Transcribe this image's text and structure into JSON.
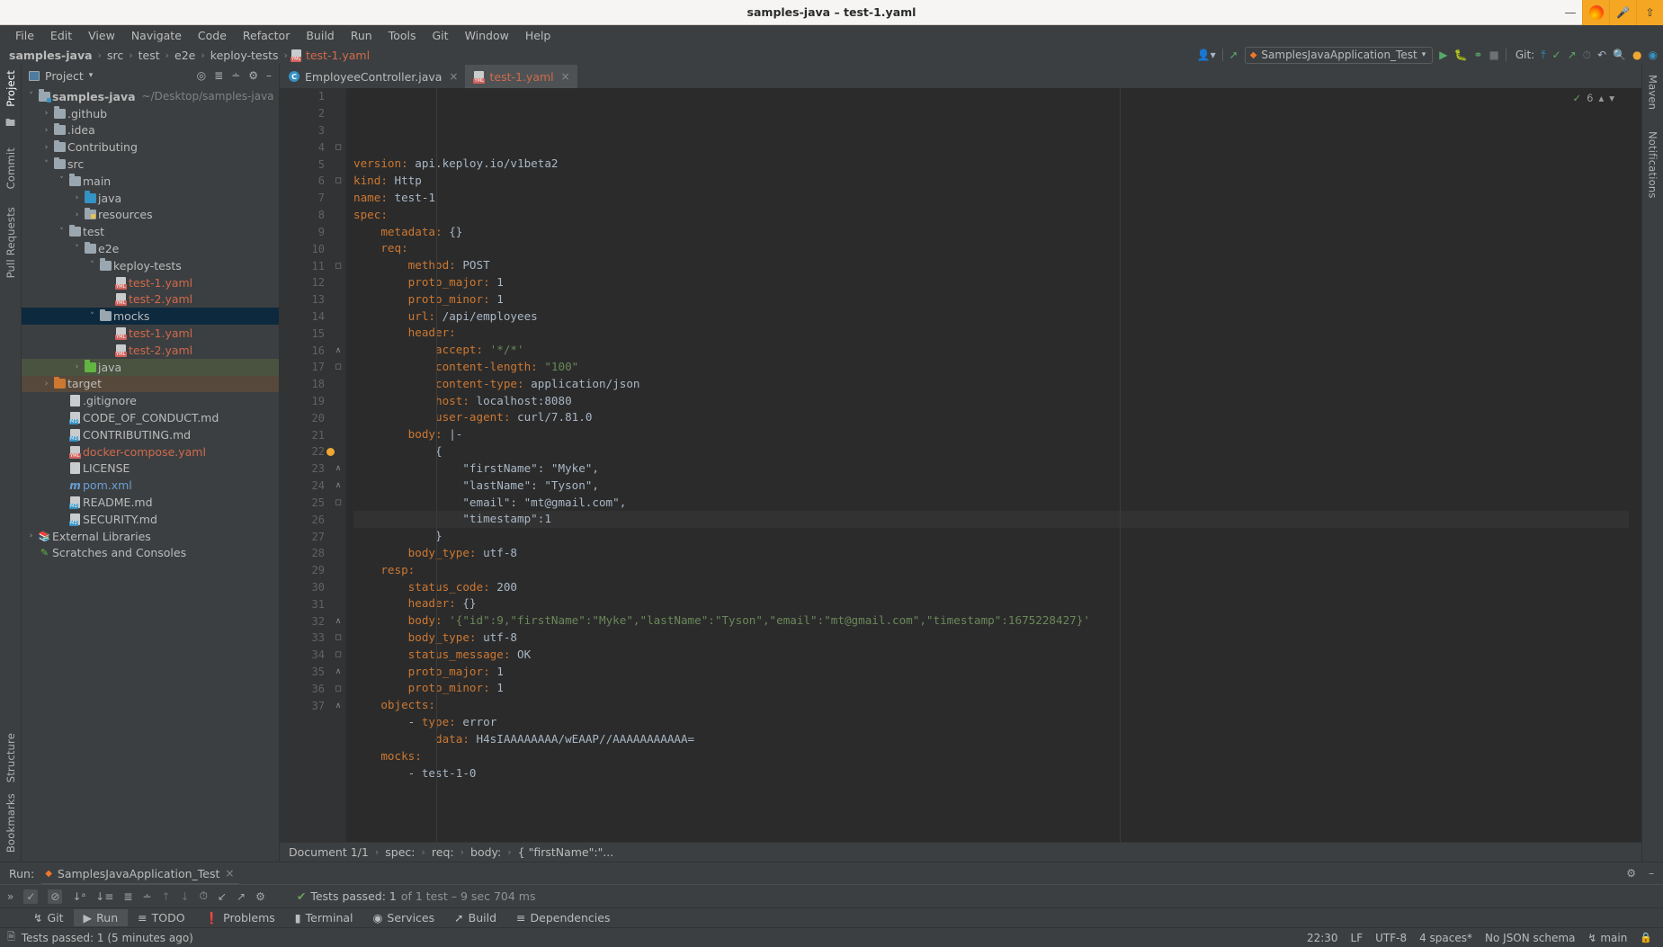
{
  "window": {
    "title": "samples-java – test-1.yaml",
    "minimize": "—",
    "tray": {
      "firefox": "firefox-icon",
      "mic": "microphone-icon",
      "upload": "upload-icon"
    }
  },
  "menubar": [
    "File",
    "Edit",
    "View",
    "Navigate",
    "Code",
    "Refactor",
    "Build",
    "Run",
    "Tools",
    "Git",
    "Window",
    "Help"
  ],
  "navbar": {
    "crumbs": [
      "samples-java",
      "src",
      "test",
      "e2e",
      "keploy-tests"
    ],
    "file": "test-1.yaml",
    "separator": "›"
  },
  "toolbar": {
    "profile_icon": "user-profile-icon",
    "updates_icon": "chevron-up-icon",
    "run_config": "SamplesJavaApplication_Test",
    "run": "run-icon",
    "debug": "debug-icon",
    "coverage": "run-with-coverage-icon",
    "stop": "stop-icon",
    "git_label": "Git:",
    "git_update": "update-project-icon",
    "git_commit": "commit-icon",
    "git_push": "push-icon",
    "git_history": "history-icon",
    "git_rollback": "rollback-icon",
    "search": "search-icon",
    "plugin_update": "plugin-update-icon",
    "ai_assistant": "ai-assistant-icon"
  },
  "left_rail": [
    "Project",
    "Commit",
    "Pull Requests",
    "Bookmarks",
    "Structure"
  ],
  "right_rail": [
    "Maven",
    "Notifications"
  ],
  "project_panel": {
    "title": "Project",
    "dropdown": "▾",
    "icons": [
      "locate-icon",
      "expand-all-icon",
      "collapse-all-icon",
      "settings-icon",
      "hide-icon"
    ],
    "tree": [
      {
        "label": "samples-java",
        "sub": "~/Desktop/samples-java",
        "depth": 0,
        "arrow": "down",
        "icon": "module",
        "bold": true
      },
      {
        "label": ".github",
        "depth": 1,
        "arrow": "right",
        "icon": "folder"
      },
      {
        "label": ".idea",
        "depth": 1,
        "arrow": "right",
        "icon": "folder"
      },
      {
        "label": "Contributing",
        "depth": 1,
        "arrow": "right",
        "icon": "folder"
      },
      {
        "label": "src",
        "depth": 1,
        "arrow": "down",
        "icon": "folder"
      },
      {
        "label": "main",
        "depth": 2,
        "arrow": "down",
        "icon": "folder"
      },
      {
        "label": "java",
        "depth": 3,
        "arrow": "right",
        "icon": "folder-blue"
      },
      {
        "label": "resources",
        "depth": 3,
        "arrow": "right",
        "icon": "folder-res"
      },
      {
        "label": "test",
        "depth": 2,
        "arrow": "down",
        "icon": "folder"
      },
      {
        "label": "e2e",
        "depth": 3,
        "arrow": "down",
        "icon": "folder"
      },
      {
        "label": "keploy-tests",
        "depth": 4,
        "arrow": "down",
        "icon": "folder"
      },
      {
        "label": "test-1.yaml",
        "depth": 5,
        "arrow": "none",
        "icon": "yaml"
      },
      {
        "label": "test-2.yaml",
        "depth": 5,
        "arrow": "none",
        "icon": "yaml"
      },
      {
        "label": "mocks",
        "depth": 4,
        "arrow": "down",
        "icon": "folder",
        "state": "selected"
      },
      {
        "label": "test-1.yaml",
        "depth": 5,
        "arrow": "none",
        "icon": "yaml"
      },
      {
        "label": "test-2.yaml",
        "depth": 5,
        "arrow": "none",
        "icon": "yaml"
      },
      {
        "label": "java",
        "depth": 3,
        "arrow": "right",
        "icon": "folder-green",
        "state": "test-source"
      },
      {
        "label": "target",
        "depth": 1,
        "arrow": "right",
        "icon": "folder-orange",
        "state": "excluded"
      },
      {
        "label": ".gitignore",
        "depth": 2,
        "arrow": "none",
        "icon": "gitignore"
      },
      {
        "label": "CODE_OF_CONDUCT.md",
        "depth": 2,
        "arrow": "none",
        "icon": "md"
      },
      {
        "label": "CONTRIBUTING.md",
        "depth": 2,
        "arrow": "none",
        "icon": "md"
      },
      {
        "label": "docker-compose.yaml",
        "depth": 2,
        "arrow": "none",
        "icon": "yaml"
      },
      {
        "label": "LICENSE",
        "depth": 2,
        "arrow": "none",
        "icon": "file"
      },
      {
        "label": "pom.xml",
        "depth": 2,
        "arrow": "none",
        "icon": "maven"
      },
      {
        "label": "README.md",
        "depth": 2,
        "arrow": "none",
        "icon": "md"
      },
      {
        "label": "SECURITY.md",
        "depth": 2,
        "arrow": "none",
        "icon": "md"
      },
      {
        "label": "External Libraries",
        "depth": 0,
        "arrow": "right",
        "icon": "library"
      },
      {
        "label": "Scratches and Consoles",
        "depth": 0,
        "arrow": "none",
        "icon": "scratch"
      }
    ]
  },
  "editor": {
    "tabs": [
      {
        "label": "EmployeeController.java",
        "icon": "java-class-icon",
        "active": false,
        "close": "×"
      },
      {
        "label": "test-1.yaml",
        "icon": "yaml-file-icon",
        "active": true,
        "close": "×"
      }
    ],
    "inspection_count": "6",
    "inspection_icon": "inspection-warning-icon",
    "lines": [
      {
        "n": 1,
        "fold": "",
        "text": "version: api.keploy.io/v1beta2",
        "key": "version",
        "indent": 0
      },
      {
        "n": 2,
        "fold": "",
        "text": "kind: Http",
        "key": "kind",
        "indent": 0
      },
      {
        "n": 3,
        "fold": "",
        "text": "name: test-1",
        "key": "name",
        "indent": 0
      },
      {
        "n": 4,
        "fold": "open",
        "text": "spec:",
        "key": "spec",
        "indent": 0
      },
      {
        "n": 5,
        "fold": "",
        "text": "metadata: {}",
        "key": "metadata",
        "indent": 1
      },
      {
        "n": 6,
        "fold": "open",
        "text": "req:",
        "key": "req",
        "indent": 1
      },
      {
        "n": 7,
        "fold": "",
        "text": "method: POST",
        "key": "method",
        "indent": 2
      },
      {
        "n": 8,
        "fold": "",
        "text": "proto_major: 1",
        "key": "proto_major",
        "indent": 2
      },
      {
        "n": 9,
        "fold": "",
        "text": "proto_minor: 1",
        "key": "proto_minor",
        "indent": 2
      },
      {
        "n": 10,
        "fold": "",
        "text": "url: /api/employees",
        "key": "url",
        "indent": 2
      },
      {
        "n": 11,
        "fold": "open",
        "text": "header:",
        "key": "header",
        "indent": 2
      },
      {
        "n": 12,
        "fold": "",
        "text": "accept: '*/*'",
        "key": "accept",
        "indent": 3
      },
      {
        "n": 13,
        "fold": "",
        "text": "content-length: \"100\"",
        "key": "content-length",
        "indent": 3
      },
      {
        "n": 14,
        "fold": "",
        "text": "content-type: application/json",
        "key": "content-type",
        "indent": 3
      },
      {
        "n": 15,
        "fold": "",
        "text": "host: localhost:8080",
        "key": "host",
        "indent": 3
      },
      {
        "n": 16,
        "fold": "close",
        "text": "user-agent: curl/7.81.0",
        "key": "user-agent",
        "indent": 3
      },
      {
        "n": 17,
        "fold": "open",
        "text": "body: |-",
        "key": "body",
        "indent": 2
      },
      {
        "n": 18,
        "fold": "",
        "text": "{",
        "indent": 3
      },
      {
        "n": 19,
        "fold": "",
        "text": "\"firstName\": \"Myke\",",
        "indent": 4
      },
      {
        "n": 20,
        "fold": "",
        "text": "\"lastName\": \"Tyson\",",
        "indent": 4
      },
      {
        "n": 21,
        "fold": "",
        "text": "\"email\": \"mt@gmail.com\",",
        "indent": 4
      },
      {
        "n": 22,
        "fold": "",
        "text": "\"timestamp\":1",
        "indent": 4,
        "gutter_icon": "intention-bulb-icon",
        "highlight": true
      },
      {
        "n": 23,
        "fold": "close",
        "text": "}",
        "indent": 3
      },
      {
        "n": 24,
        "fold": "close",
        "text": "body_type: utf-8",
        "key": "body_type",
        "indent": 2
      },
      {
        "n": 25,
        "fold": "open",
        "text": "resp:",
        "key": "resp",
        "indent": 1
      },
      {
        "n": 26,
        "fold": "",
        "text": "status_code: 200",
        "key": "status_code",
        "indent": 2
      },
      {
        "n": 27,
        "fold": "",
        "text": "header: {}",
        "key": "header",
        "indent": 2
      },
      {
        "n": 28,
        "fold": "",
        "text": "body: '{\"id\":9,\"firstName\":\"Myke\",\"lastName\":\"Tyson\",\"email\":\"mt@gmail.com\",\"timestamp\":1675228427}'",
        "key": "body",
        "indent": 2,
        "string_value": true
      },
      {
        "n": 29,
        "fold": "",
        "text": "body_type: utf-8",
        "key": "body_type",
        "indent": 2
      },
      {
        "n": 30,
        "fold": "",
        "text": "status_message: OK",
        "key": "status_message",
        "indent": 2
      },
      {
        "n": 31,
        "fold": "",
        "text": "proto_major: 1",
        "key": "proto_major",
        "indent": 2
      },
      {
        "n": 32,
        "fold": "close",
        "text": "proto_minor: 1",
        "key": "proto_minor",
        "indent": 2
      },
      {
        "n": 33,
        "fold": "open",
        "text": "objects:",
        "key": "objects",
        "indent": 1
      },
      {
        "n": 34,
        "fold": "open",
        "text": "- type: error",
        "key": "type",
        "indent": 2,
        "dash": true
      },
      {
        "n": 35,
        "fold": "close",
        "text": "data: H4sIAAAAAAAA/wEAAP//AAAAAAAAAAA=",
        "key": "data",
        "indent": 3
      },
      {
        "n": 36,
        "fold": "open",
        "text": "mocks:",
        "key": "mocks",
        "indent": 1
      },
      {
        "n": 37,
        "fold": "close",
        "text": "- test-1-0",
        "indent": 2,
        "dash": true
      }
    ],
    "crumbs": [
      "Document 1/1",
      "spec:",
      "req:",
      "body:",
      "{  \"firstName\":\"..."
    ],
    "crumb_sep": "›"
  },
  "run_window": {
    "label": "Run:",
    "tab": "SamplesJavaApplication_Test",
    "tab_icon": "run-config-icon",
    "close": "×",
    "settings_icon": "gear-icon",
    "hide_icon": "minimize-icon",
    "toolbar_icons": [
      "expand-more-icon",
      "show-passed-icon",
      "hide-ignored-icon",
      "sort-alpha-icon",
      "sort-duration-icon",
      "expand-all-icon",
      "collapse-all-icon",
      "prev-test-icon",
      "next-test-icon",
      "history-icon",
      "import-results-icon",
      "export-results-icon",
      "test-settings-icon"
    ],
    "status_check": "✔",
    "status_main": "Tests passed: 1",
    "status_detail": "of 1 test – 9 sec 704 ms"
  },
  "bottom_bar": [
    {
      "label": "Git",
      "icon": "git-branch-icon",
      "active": false
    },
    {
      "label": "Run",
      "icon": "run-icon",
      "active": true
    },
    {
      "label": "TODO",
      "icon": "todo-icon",
      "active": false
    },
    {
      "label": "Problems",
      "icon": "problems-icon",
      "active": false
    },
    {
      "label": "Terminal",
      "icon": "terminal-icon",
      "active": false
    },
    {
      "label": "Services",
      "icon": "services-icon",
      "active": false
    },
    {
      "label": "Build",
      "icon": "build-hammer-icon",
      "active": false
    },
    {
      "label": "Dependencies",
      "icon": "dependencies-icon",
      "active": false
    }
  ],
  "status_bar": {
    "message_icon": "event-log-icon",
    "message": "Tests passed: 1 (5 minutes ago)",
    "time": "22:30",
    "line_separator": "LF",
    "encoding": "UTF-8",
    "indent": "4 spaces*",
    "schema": "No JSON schema",
    "branch": "main",
    "branch_icon": "git-branch-icon",
    "lock_icon": "read-only-lock-icon"
  },
  "colors": {
    "bg": "#2b2b2b",
    "panel": "#3c3f41",
    "selection": "#0d293e",
    "key": "#cc7832",
    "string": "#6a8759",
    "value": "#a9b7c6",
    "accent_green": "#59a869",
    "accent_orange": "#f5a623",
    "yaml_file": "#cf6a4c"
  }
}
